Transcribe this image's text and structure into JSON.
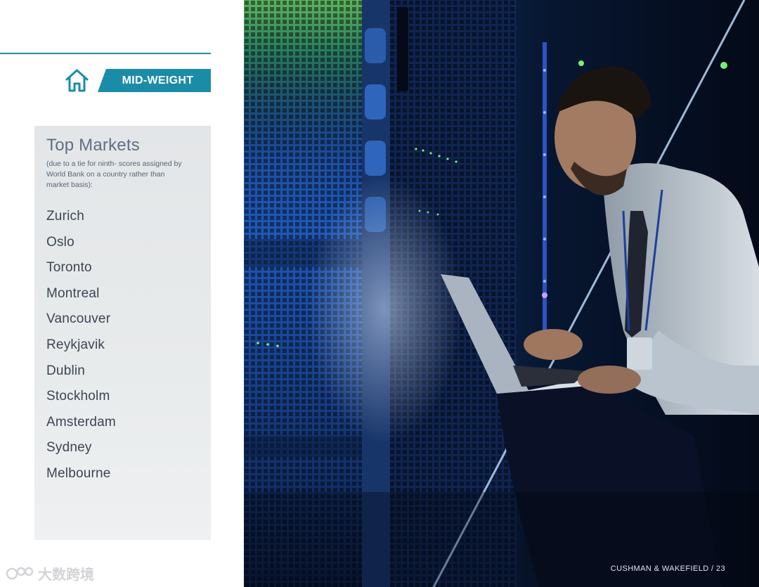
{
  "badge": {
    "label": "MID-WEIGHT"
  },
  "icons": {
    "home": "home-icon"
  },
  "markets": {
    "title": "Top Markets",
    "note": "(due to a tie for ninth- scores assigned by World Bank on a country rather than market basis):",
    "items": [
      "Zurich",
      "Oslo",
      "Toronto",
      "Montreal",
      "Vancouver",
      "Reykjavik",
      "Dublin",
      "Stockholm",
      "Amsterdam",
      "Sydney",
      "Melbourne"
    ]
  },
  "footer": {
    "text": "CUSHMAN & WAKEFIELD / 23"
  },
  "watermark": {
    "text": "大数跨境"
  },
  "colors": {
    "accent": "#1b8ca8",
    "title": "#5f6f86",
    "card_bg": "#e6e9eb"
  }
}
